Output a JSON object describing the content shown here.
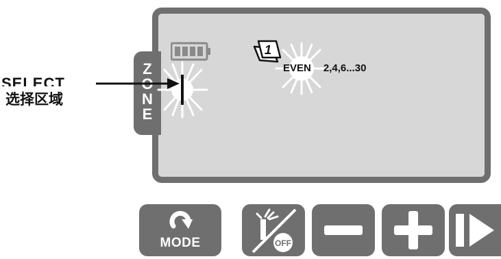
{
  "zone_tab": {
    "letters": [
      "Z",
      "O",
      "N",
      "E"
    ]
  },
  "callout": {
    "select_label": "SELECT",
    "chinese_label": "选择区域"
  },
  "display": {
    "day_icon_number": "1",
    "schedule_mode": "EVEN",
    "schedule_days": "2,4,6...30"
  },
  "buttons": {
    "mode": {
      "label": "MODE",
      "icon": "rotate-arrow-icon"
    },
    "rain_off": {
      "label": "OFF",
      "icon": "sprinkler-off-icon"
    },
    "minus": {
      "icon": "minus-icon"
    },
    "plus": {
      "icon": "plus-icon"
    },
    "next": {
      "icon": "next-icon"
    }
  },
  "colors": {
    "panel_border": "#6f6f6f",
    "panel_fill": "#d7d7d7",
    "button": "#6f6f6f"
  }
}
